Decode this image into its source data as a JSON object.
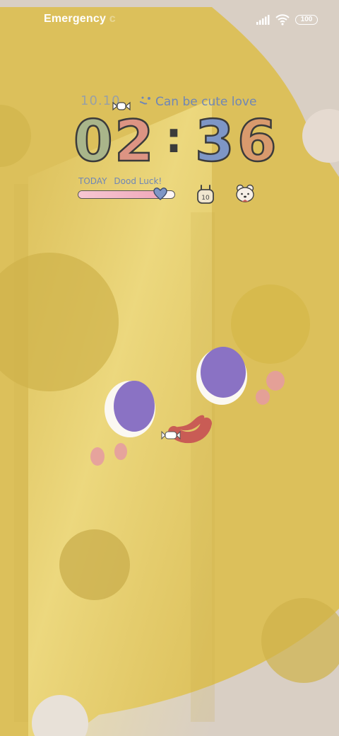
{
  "status_bar": {
    "emergency_label": "Emergency",
    "emergency_fade_char": "c",
    "battery_level": "100",
    "icons": [
      "signal-icon",
      "wifi-icon",
      "battery-icon"
    ]
  },
  "lockscreen": {
    "date": "10.10",
    "tagline": "Can be cute love",
    "time": {
      "h1": "0",
      "h2": "2",
      "m1": "3",
      "m2": "6"
    },
    "colon": ":",
    "today_label": "TODAY",
    "today_message": "Dood Luck!",
    "day_progress": 0.85,
    "widget_icons": [
      "bunny-battery-icon",
      "bear-icon"
    ],
    "bunny_badge": "10"
  },
  "colors": {
    "wallpaper_yellow": "#dcc05b",
    "corner_beige": "#d9cfc4",
    "eye_purple": "#8a72c4",
    "blush_pink": "#e59aa2",
    "tongue_red": "#c95c55",
    "digit_green": "#a9b58a",
    "digit_pink": "#dd9483",
    "digit_blue": "#7e96c6",
    "digit_orange": "#d99a6d",
    "text_blue": "#6f86b6"
  }
}
